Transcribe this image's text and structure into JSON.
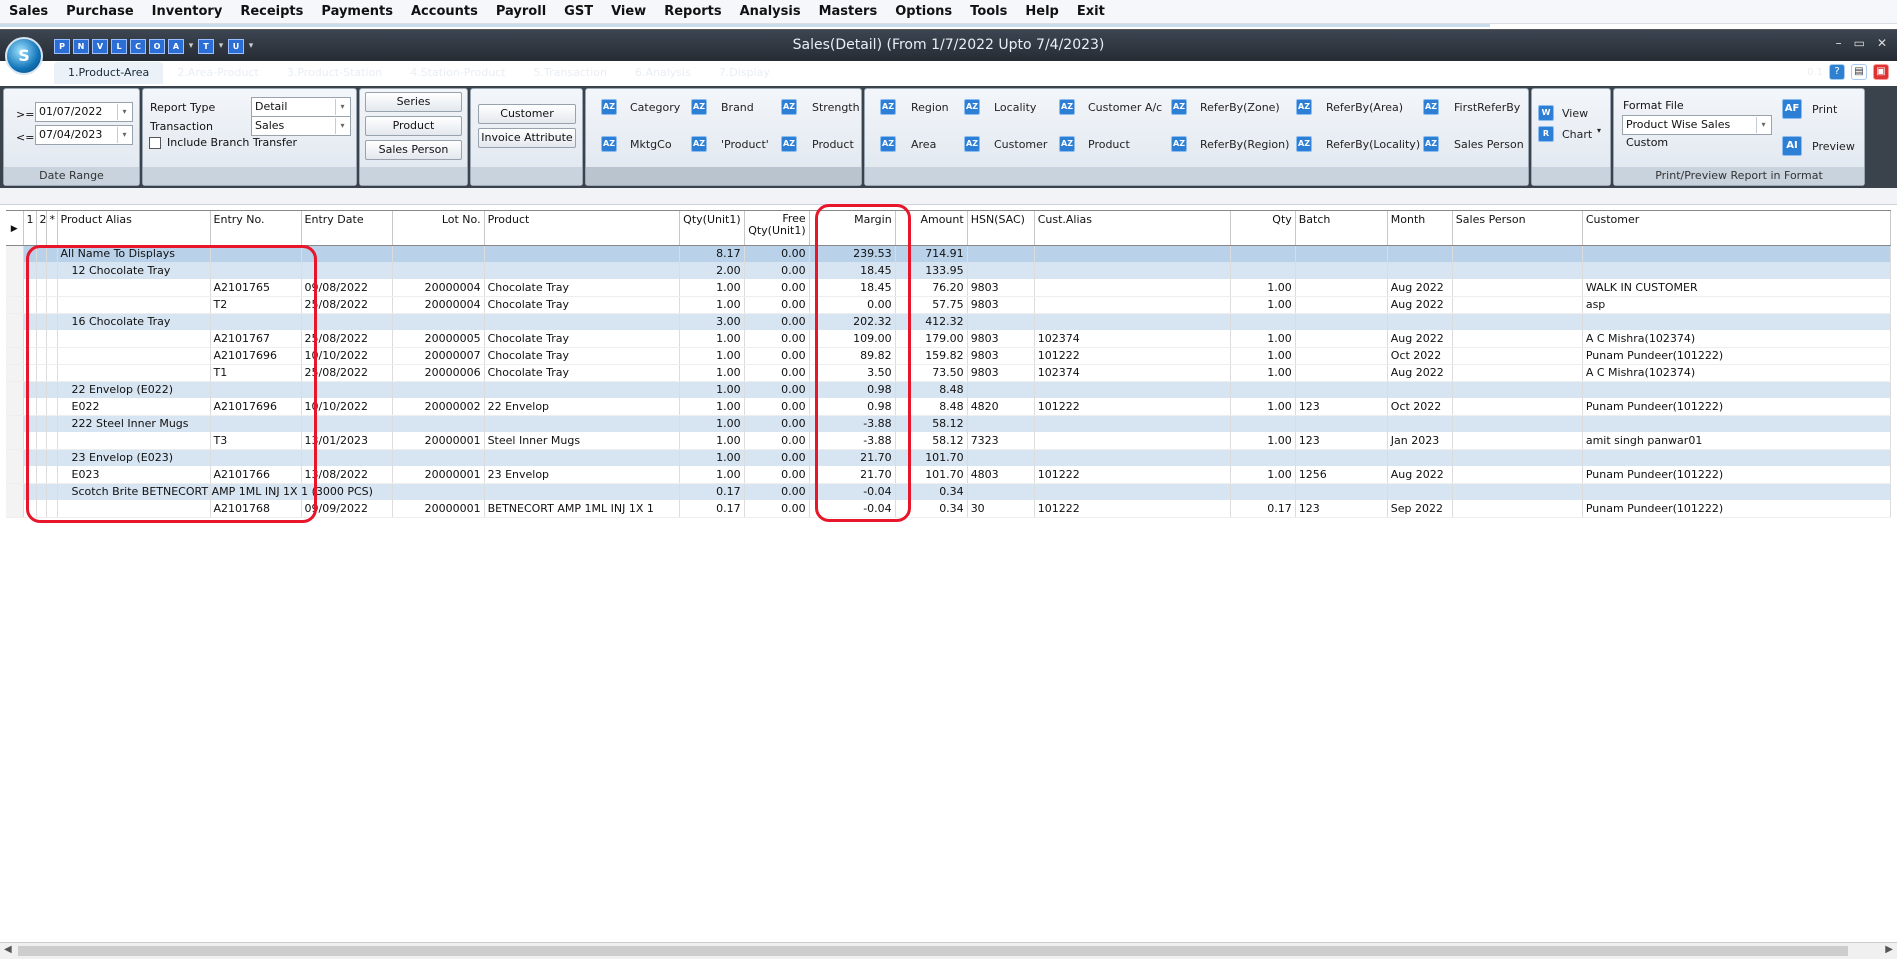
{
  "menu": [
    "Sales",
    "Purchase",
    "Inventory",
    "Receipts",
    "Payments",
    "Accounts",
    "Payroll",
    "GST",
    "View",
    "Reports",
    "Analysis",
    "Masters",
    "Options",
    "Tools",
    "Help",
    "Exit"
  ],
  "window": {
    "title": "Sales(Detail) (From 1/7/2022 Upto 7/4/2023)",
    "logo_text": "S",
    "version": "0.1",
    "minimize": "–",
    "maximize": "▭",
    "close": "✕"
  },
  "quick_access": [
    "P",
    "N",
    "V",
    "L",
    "C",
    "O",
    "A",
    "T",
    "U"
  ],
  "tabs": [
    "1.Product-Area",
    "2.Area-Product",
    "3.Product-Station",
    "4.Station-Product",
    "5.Transaction",
    "6.Analysis",
    "7.Display"
  ],
  "ribbon": {
    "date_range": {
      "from_op": ">=",
      "from": "01/07/2022",
      "to_op": "<=",
      "to": "07/04/2023",
      "label": "Date Range"
    },
    "report": {
      "type_label": "Report Type",
      "type_value": "Detail",
      "transaction_label": "Transaction",
      "transaction_value": "Sales",
      "branch_label": "Include Branch Transfer"
    },
    "buttons1": [
      "Series",
      "Product",
      "Sales Person"
    ],
    "buttons2": [
      "Customer",
      "Invoice Attribute"
    ],
    "product_fields": [
      "Category",
      "Brand",
      "Strength",
      "MktgCo",
      "'Product'",
      "Product"
    ],
    "area_fields": [
      "Region",
      "Locality",
      "Customer A/c",
      "ReferBy(Zone)",
      "ReferBy(Area)",
      "FirstReferBy",
      "Area",
      "Customer",
      "Product",
      "ReferBy(Region)",
      "ReferBy(Locality)",
      "Sales Person"
    ],
    "view": [
      "View",
      "Chart"
    ],
    "format": {
      "label": "Format File",
      "value": "Product Wise Sales Custom",
      "print": "Print",
      "preview": "Preview",
      "footer": "Print/Preview Report in Format"
    }
  },
  "table": {
    "headers": [
      "1",
      "2",
      "*",
      "Product Alias",
      "Entry No.",
      "Entry Date",
      "Lot No.",
      "Product",
      "Qty(Unit1)",
      "Free Qty(Unit1)",
      "Margin",
      "Amount",
      "HSN(SAC)",
      "Cust.Alias",
      "Qty",
      "Batch",
      "Month",
      "Sales Person",
      "Customer"
    ],
    "rows": [
      {
        "kind": "sel",
        "alias": "All Name To Displays",
        "indent": 0,
        "entry": "",
        "date": "",
        "lot": "",
        "product": "",
        "qty": "8.17",
        "free": "0.00",
        "margin": "239.53",
        "amount": "714.91",
        "hsn": "",
        "calias": "",
        "q2": "",
        "batch": "",
        "month": "",
        "sp": "",
        "cust": ""
      },
      {
        "kind": "grp",
        "alias": "12 Chocolate Tray",
        "indent": 1,
        "entry": "",
        "date": "",
        "lot": "",
        "product": "",
        "qty": "2.00",
        "free": "0.00",
        "margin": "18.45",
        "amount": "133.95",
        "hsn": "",
        "calias": "",
        "q2": "",
        "batch": "",
        "month": "",
        "sp": "",
        "cust": ""
      },
      {
        "kind": "det",
        "alias": "",
        "indent": 0,
        "entry": "A2101765",
        "date": "09/08/2022",
        "lot": "20000004",
        "product": "Chocolate Tray",
        "qty": "1.00",
        "free": "0.00",
        "margin": "18.45",
        "amount": "76.20",
        "hsn": "9803",
        "calias": "",
        "q2": "1.00",
        "batch": "",
        "month": "Aug 2022",
        "sp": "",
        "cust": "WALK IN CUSTOMER"
      },
      {
        "kind": "det",
        "alias": "",
        "indent": 0,
        "entry": "T2",
        "date": "25/08/2022",
        "lot": "20000004",
        "product": "Chocolate Tray",
        "qty": "1.00",
        "free": "0.00",
        "margin": "0.00",
        "amount": "57.75",
        "hsn": "9803",
        "calias": "",
        "q2": "1.00",
        "batch": "",
        "month": "Aug 2022",
        "sp": "",
        "cust": "asp"
      },
      {
        "kind": "grp",
        "alias": "16 Chocolate Tray",
        "indent": 1,
        "entry": "",
        "date": "",
        "lot": "",
        "product": "",
        "qty": "3.00",
        "free": "0.00",
        "margin": "202.32",
        "amount": "412.32",
        "hsn": "",
        "calias": "",
        "q2": "",
        "batch": "",
        "month": "",
        "sp": "",
        "cust": ""
      },
      {
        "kind": "det",
        "alias": "",
        "indent": 0,
        "entry": "A2101767",
        "date": "25/08/2022",
        "lot": "20000005",
        "product": "Chocolate Tray",
        "qty": "1.00",
        "free": "0.00",
        "margin": "109.00",
        "amount": "179.00",
        "hsn": "9803",
        "calias": "102374",
        "q2": "1.00",
        "batch": "",
        "month": "Aug 2022",
        "sp": "",
        "cust": "A C Mishra(102374)"
      },
      {
        "kind": "det",
        "alias": "",
        "indent": 0,
        "entry": "A21017696",
        "date": "10/10/2022",
        "lot": "20000007",
        "product": "Chocolate Tray",
        "qty": "1.00",
        "free": "0.00",
        "margin": "89.82",
        "amount": "159.82",
        "hsn": "9803",
        "calias": "101222",
        "q2": "1.00",
        "batch": "",
        "month": "Oct 2022",
        "sp": "",
        "cust": " Punam Pundeer(101222)"
      },
      {
        "kind": "det",
        "alias": "",
        "indent": 0,
        "entry": "T1",
        "date": "25/08/2022",
        "lot": "20000006",
        "product": "Chocolate Tray",
        "qty": "1.00",
        "free": "0.00",
        "margin": "3.50",
        "amount": "73.50",
        "hsn": "9803",
        "calias": "102374",
        "q2": "1.00",
        "batch": "",
        "month": "Aug 2022",
        "sp": "",
        "cust": "A C Mishra(102374)"
      },
      {
        "kind": "grp",
        "alias": "22 Envelop (E022)",
        "indent": 1,
        "entry": "",
        "date": "",
        "lot": "",
        "product": "",
        "qty": "1.00",
        "free": "0.00",
        "margin": "0.98",
        "amount": "8.48",
        "hsn": "",
        "calias": "",
        "q2": "",
        "batch": "",
        "month": "",
        "sp": "",
        "cust": ""
      },
      {
        "kind": "det",
        "alias": "E022",
        "indent": 1,
        "entry": "A21017696",
        "date": "10/10/2022",
        "lot": "20000002",
        "product": "22 Envelop",
        "qty": "1.00",
        "free": "0.00",
        "margin": "0.98",
        "amount": "8.48",
        "hsn": "4820",
        "calias": "101222",
        "q2": "1.00",
        "batch": "123",
        "month": "Oct 2022",
        "sp": "",
        "cust": " Punam Pundeer(101222)"
      },
      {
        "kind": "grp",
        "alias": "222 Steel Inner Mugs",
        "indent": 1,
        "entry": "",
        "date": "",
        "lot": "",
        "product": "",
        "qty": "1.00",
        "free": "0.00",
        "margin": "-3.88",
        "amount": "58.12",
        "hsn": "",
        "calias": "",
        "q2": "",
        "batch": "",
        "month": "",
        "sp": "",
        "cust": ""
      },
      {
        "kind": "det",
        "alias": "",
        "indent": 0,
        "entry": "T3",
        "date": "13/01/2023",
        "lot": "20000001",
        "product": "Steel Inner Mugs",
        "qty": "1.00",
        "free": "0.00",
        "margin": "-3.88",
        "amount": "58.12",
        "hsn": "7323",
        "calias": "",
        "q2": "1.00",
        "batch": "123",
        "month": "Jan 2023",
        "sp": "",
        "cust": "amit singh panwar01"
      },
      {
        "kind": "grp",
        "alias": "23 Envelop (E023)",
        "indent": 1,
        "entry": "",
        "date": "",
        "lot": "",
        "product": "",
        "qty": "1.00",
        "free": "0.00",
        "margin": "21.70",
        "amount": "101.70",
        "hsn": "",
        "calias": "",
        "q2": "",
        "batch": "",
        "month": "",
        "sp": "",
        "cust": ""
      },
      {
        "kind": "det",
        "alias": "E023",
        "indent": 1,
        "entry": "A2101766",
        "date": "13/08/2022",
        "lot": "20000001",
        "product": "23 Envelop",
        "qty": "1.00",
        "free": "0.00",
        "margin": "21.70",
        "amount": "101.70",
        "hsn": "4803",
        "calias": "101222",
        "q2": "1.00",
        "batch": "1256",
        "month": "Aug 2022",
        "sp": "",
        "cust": " Punam Pundeer(101222)"
      },
      {
        "kind": "grp",
        "alias": "Scotch Brite BETNECORT AMP 1ML INJ 1X 1 (3000 PCS)",
        "indent": 1,
        "entry": "",
        "date": "",
        "lot": "",
        "product": "",
        "qty": "0.17",
        "free": "0.00",
        "margin": "-0.04",
        "amount": "0.34",
        "hsn": "",
        "calias": "",
        "q2": "",
        "batch": "",
        "month": "",
        "sp": "",
        "cust": ""
      },
      {
        "kind": "det",
        "alias": "",
        "indent": 0,
        "entry": "A2101768",
        "date": "09/09/2022",
        "lot": "20000001",
        "product": "BETNECORT AMP 1ML INJ 1X 1",
        "qty": "0.17",
        "free": "0.00",
        "margin": "-0.04",
        "amount": "0.34",
        "hsn": "30",
        "calias": "101222",
        "q2": "0.17",
        "batch": "123",
        "month": "Sep 2022",
        "sp": "",
        "cust": " Punam Pundeer(101222)"
      }
    ]
  },
  "colors": {
    "highlight": "#e8162a",
    "group_row": "#d7e4f1",
    "selected_row": "#b9d1e9"
  }
}
